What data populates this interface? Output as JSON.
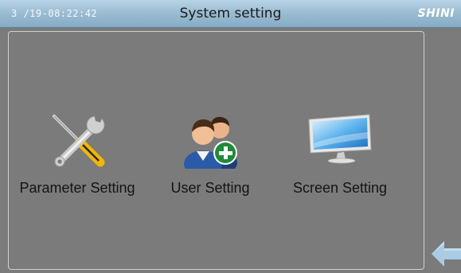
{
  "header": {
    "datetime": "3 /19-08:22:42",
    "title": "System setting",
    "logo": "SHINI"
  },
  "tiles": [
    {
      "label": "Parameter Setting",
      "icon": "tools-icon"
    },
    {
      "label": "User Setting",
      "icon": "user-add-icon"
    },
    {
      "label": "Screen Setting",
      "icon": "monitor-icon"
    }
  ],
  "nav": {
    "back_icon": "back-arrow-icon"
  },
  "colors": {
    "background": "#7b7b7b",
    "header": "#9cbdd3",
    "text": "#141414"
  }
}
